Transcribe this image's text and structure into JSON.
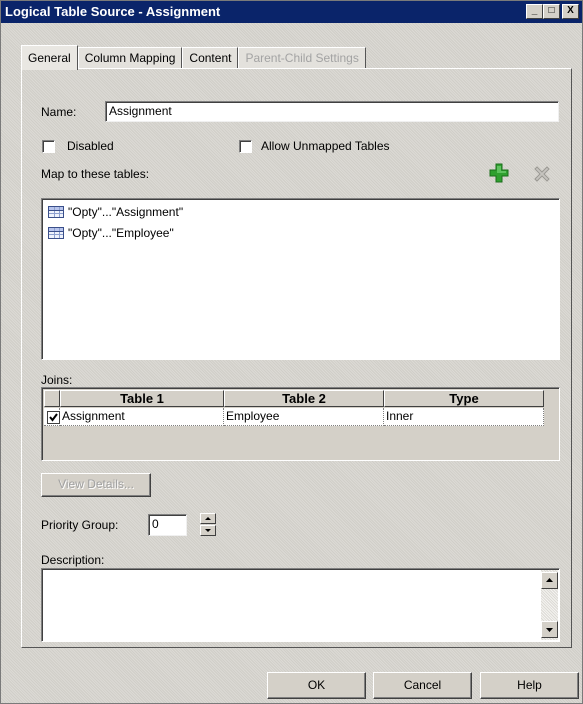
{
  "window": {
    "title": "Logical Table Source - Assignment",
    "minimize_glyph": "_",
    "maximize_glyph": "□",
    "close_glyph": "X"
  },
  "tabs": [
    {
      "label": "General",
      "state": "active"
    },
    {
      "label": "Column Mapping",
      "state": "normal"
    },
    {
      "label": "Content",
      "state": "normal"
    },
    {
      "label": "Parent-Child Settings",
      "state": "disabled"
    }
  ],
  "general": {
    "name_label": "Name:",
    "name_value": "Assignment",
    "disabled_label": "Disabled",
    "disabled_checked": false,
    "allow_unmapped_label": "Allow Unmapped Tables",
    "allow_unmapped_checked": false,
    "map_label": "Map to these tables:",
    "add_icon": "green-plus-icon",
    "remove_icon": "gray-x-icon",
    "mapped_tables": [
      {
        "label": "\"Opty\"...\"Assignment\"",
        "icon": "table-icon"
      },
      {
        "label": "\"Opty\"...\"Employee\"",
        "icon": "table-icon"
      }
    ],
    "joins_label": "Joins:",
    "joins_columns": [
      "Table 1",
      "Table 2",
      "Type"
    ],
    "joins_rows": [
      {
        "checked": true,
        "table1": "Assignment",
        "table2": "Employee",
        "type": "Inner"
      }
    ],
    "view_details_label": "View Details...",
    "priority_label": "Priority Group:",
    "priority_value": "0",
    "description_label": "Description:",
    "description_value": ""
  },
  "footer": {
    "ok_label": "OK",
    "cancel_label": "Cancel",
    "help_label": "Help"
  },
  "colors": {
    "titlebar": "#0a246a",
    "dialog_bg": "#d8d6d0",
    "add_icon": "#2fa02f"
  }
}
